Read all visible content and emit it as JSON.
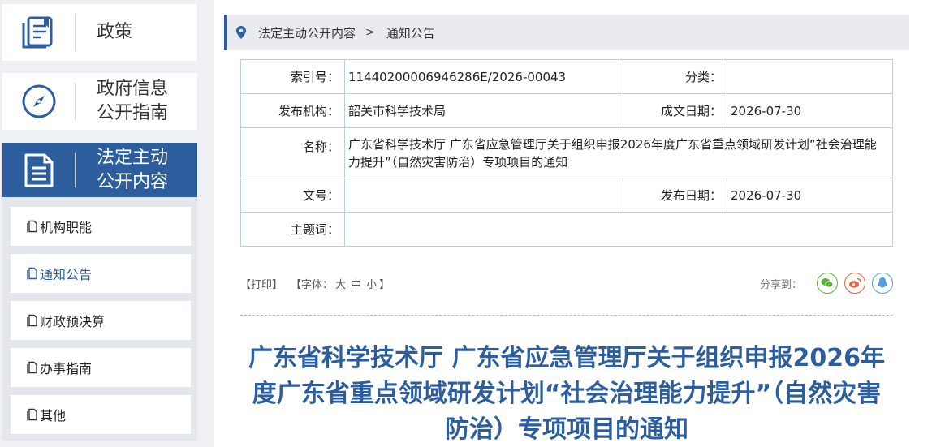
{
  "sidebar": {
    "tiles": [
      {
        "label": "政策",
        "icon": "document-stack-icon"
      },
      {
        "label": "政府信息\n公开指南",
        "icon": "compass-icon"
      },
      {
        "label": "法定主动\n公开内容",
        "icon": "document-lines-icon"
      }
    ],
    "subitems": [
      {
        "label": "机构职能"
      },
      {
        "label": "通知公告"
      },
      {
        "label": "财政预决算"
      },
      {
        "label": "办事指南"
      },
      {
        "label": "其他"
      }
    ]
  },
  "breadcrumb": {
    "parent": "法定主动公开内容",
    "separator": ">",
    "current": "通知公告"
  },
  "meta": {
    "index_label": "索引号：",
    "index_value": "11440200006946286E/2026-00043",
    "category_label": "分类：",
    "category_value": "",
    "publisher_label": "发布机构：",
    "publisher_value": "韶关市科学技术局",
    "created_label": "成文日期：",
    "created_value": "2026-07-30",
    "name_label": "名称：",
    "name_value": "广东省科学技术厅 广东省应急管理厅关于组织申报2026年度广东省重点领域研发计划“社会治理能力提升”（自然灾害防治）专项项目的通知",
    "docno_label": "文号：",
    "docno_value": "",
    "published_label": "发布日期：",
    "published_value": "2026-07-30",
    "keywords_label": "主题词：",
    "keywords_value": ""
  },
  "toolbar": {
    "print": "【打印】",
    "font_prefix": "【字体：",
    "font_large": "大",
    "font_medium": "中",
    "font_small": "小",
    "font_suffix": "】",
    "share_label": "分享到："
  },
  "article": {
    "title": "广东省科学技术厅 广东省应急管理厅关于组织申报2026年度广东省重点领域研发计划“社会治理能力提升”（自然灾害防治）专项项目的通知"
  },
  "colors": {
    "accent": "#2c5e9e",
    "wechat": "#5fb336",
    "weibo": "#e8633f",
    "qq": "#4f9fe0"
  }
}
